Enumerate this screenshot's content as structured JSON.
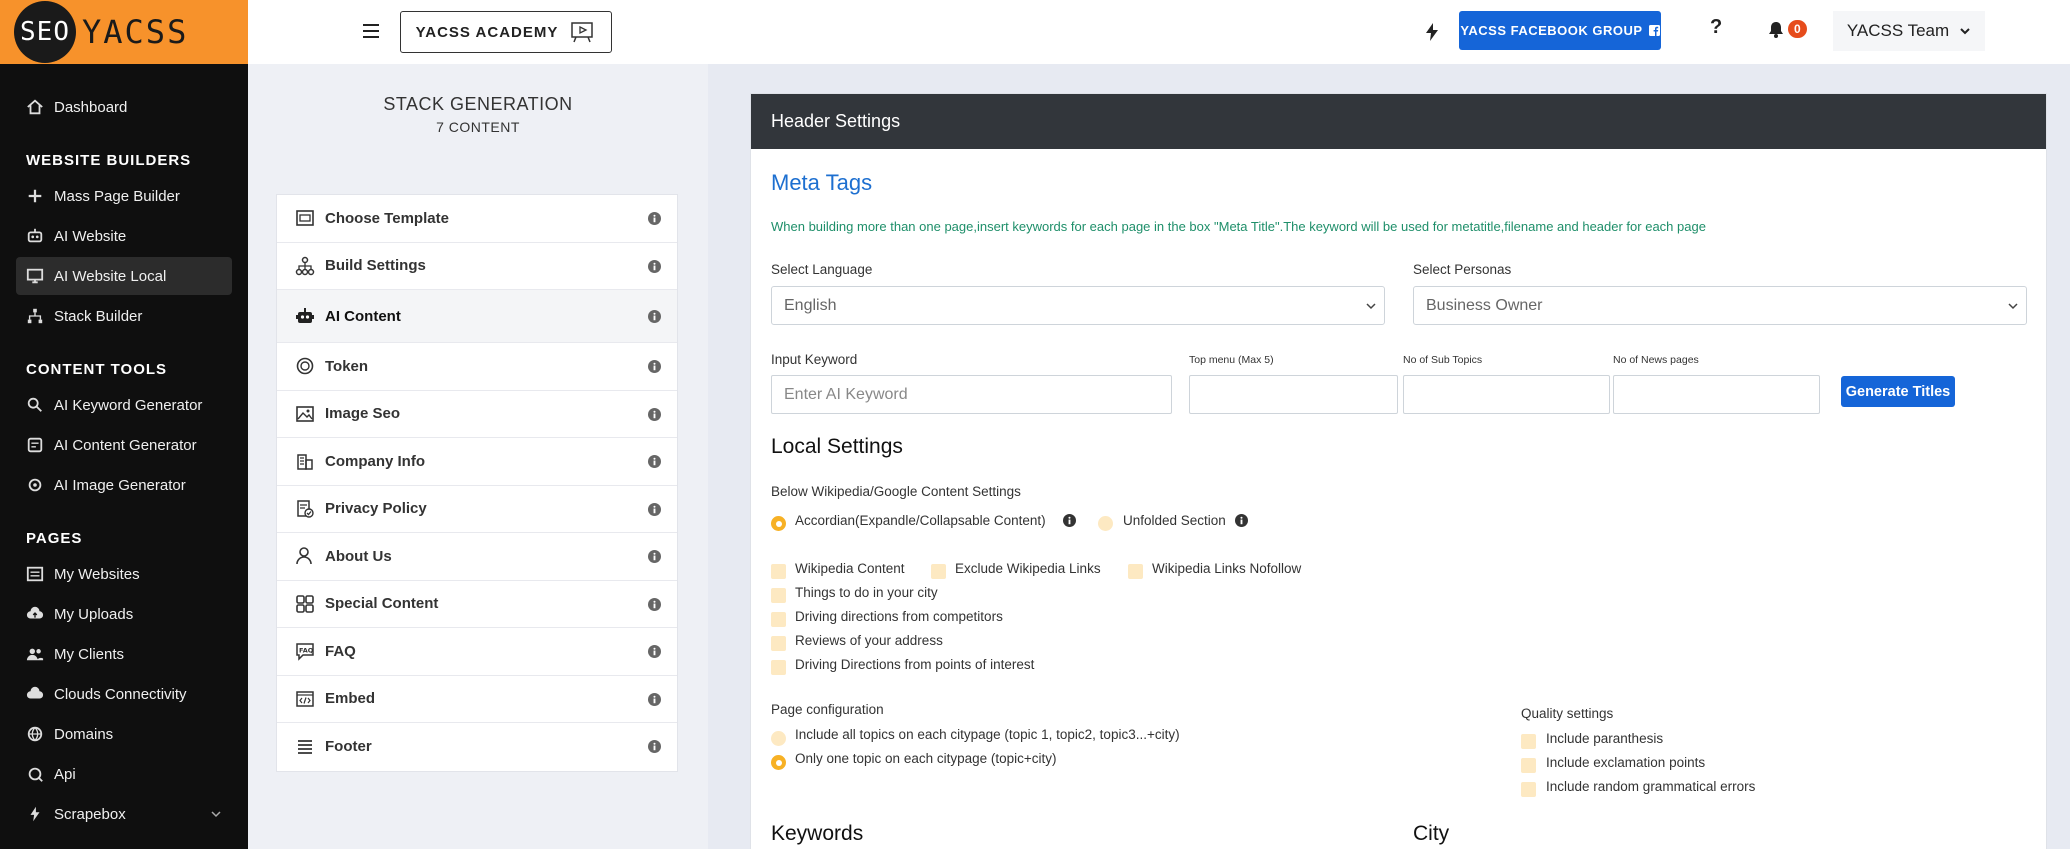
{
  "logo": {
    "seo": "SEO",
    "yacss": "YACSS"
  },
  "sidebar": {
    "dashboard": "Dashboard",
    "sections": [
      {
        "title": "WEBSITE BUILDERS",
        "items": [
          "Mass Page Builder",
          "AI Website",
          "AI Website Local",
          "Stack Builder"
        ]
      },
      {
        "title": "CONTENT TOOLS",
        "items": [
          "AI Keyword Generator",
          "AI Content Generator",
          "AI Image Generator"
        ]
      },
      {
        "title": "PAGES",
        "items": [
          "My Websites",
          "My Uploads",
          "My Clients",
          "Clouds Connectivity",
          "Domains",
          "Api",
          "Scrapebox"
        ]
      }
    ],
    "active_item": "AI Website Local"
  },
  "topbar": {
    "academy_label": "YACSS ACADEMY",
    "facebook_label": "YACSS FACEBOOK GROUP",
    "help_label": "?",
    "notifications_count": "0",
    "team_label": "YACSS Team"
  },
  "stack": {
    "title": "STACK GENERATION",
    "subtitle": "7 CONTENT",
    "steps": [
      "Choose Template",
      "Build Settings",
      "AI Content",
      "Token",
      "Image Seo",
      "Company Info",
      "Privacy Policy",
      "About Us",
      "Special Content",
      "FAQ",
      "Embed",
      "Footer"
    ],
    "active_step": "AI Content"
  },
  "panel": {
    "header": "Header Settings",
    "meta_title": "Meta Tags",
    "note": "When building more than one page,insert keywords for each page in the box \"Meta Title\".The keyword will be used for metatitle,filename and header for each page",
    "language_label": "Select Language",
    "language_value": "English",
    "personas_label": "Select Personas",
    "personas_value": "Business Owner",
    "keyword_label": "Input Keyword",
    "keyword_placeholder": "Enter AI Keyword",
    "top_menu_label": "Top menu (Max 5)",
    "sub_topics_label": "No of Sub Topics",
    "news_pages_label": "No of News pages",
    "generate_label": "Generate Titles",
    "local_title": "Local Settings",
    "below_wiki_label": "Below Wikipedia/Google Content Settings",
    "accordion_label": "Accordian(Expandle/Collapsable Content)",
    "unfolded_label": "Unfolded Section",
    "wiki_content": "Wikipedia Content",
    "exclude_wiki": "Exclude Wikipedia Links",
    "wiki_nofollow": "Wikipedia Links Nofollow",
    "things_to_do": "Things to do in your city",
    "driving_competitors": "Driving directions from competitors",
    "reviews": "Reviews of your address",
    "driving_poi": "Driving Directions from points of interest",
    "page_config_label": "Page configuration",
    "include_all_topics": "Include all topics on each citypage (topic 1, topic2, topic3...+city)",
    "one_topic": "Only one topic on each citypage (topic+city)",
    "quality_label": "Quality settings",
    "include_parenthesis": "Include paranthesis",
    "include_exclamation": "Include exclamation points",
    "include_errors": "Include random grammatical errors",
    "keywords_title": "Keywords",
    "city_title": "City"
  }
}
